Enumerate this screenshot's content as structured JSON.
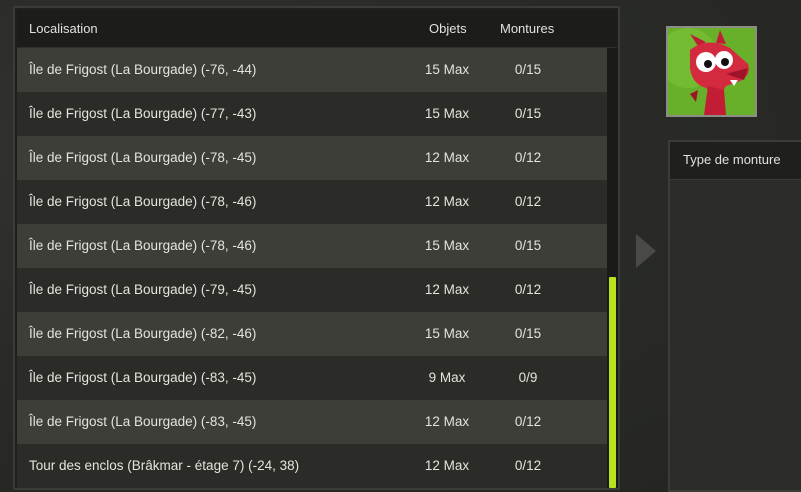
{
  "table": {
    "headers": {
      "location": "Localisation",
      "objects": "Objets",
      "mounts": "Montures"
    },
    "rows": [
      {
        "location": "Île de Frigost (La Bourgade) (-76, -44)",
        "objects": "15 Max",
        "mounts": "0/15"
      },
      {
        "location": "Île de Frigost (La Bourgade) (-77, -43)",
        "objects": "15 Max",
        "mounts": "0/15"
      },
      {
        "location": "Île de Frigost (La Bourgade) (-78, -45)",
        "objects": "12 Max",
        "mounts": "0/12"
      },
      {
        "location": "Île de Frigost (La Bourgade) (-78, -46)",
        "objects": "12 Max",
        "mounts": "0/12"
      },
      {
        "location": "Île de Frigost (La Bourgade) (-78, -46)",
        "objects": "15 Max",
        "mounts": "0/15"
      },
      {
        "location": "Île de Frigost (La Bourgade) (-79, -45)",
        "objects": "12 Max",
        "mounts": "0/12"
      },
      {
        "location": "Île de Frigost (La Bourgade) (-82, -46)",
        "objects": "15 Max",
        "mounts": "0/15"
      },
      {
        "location": "Île de Frigost (La Bourgade) (-83, -45)",
        "objects": "9 Max",
        "mounts": "0/9"
      },
      {
        "location": "Île de Frigost (La Bourgade) (-83, -45)",
        "objects": "12 Max",
        "mounts": "0/12"
      },
      {
        "location": "Tour des enclos (Brâkmar - étage 7) (-24, 38)",
        "objects": "12 Max",
        "mounts": "0/12"
      }
    ],
    "scroll": {
      "thumb_start": 0.52,
      "thumb_end": 1.0
    }
  },
  "right_panel": {
    "header": "Type de monture"
  },
  "avatar": {
    "icon": "dragoturkey-icon",
    "background": "#6bb52a"
  },
  "colors": {
    "accent": "#b8e21d",
    "row_light": "#3d3e38",
    "row_dark": "#2b2c28"
  }
}
